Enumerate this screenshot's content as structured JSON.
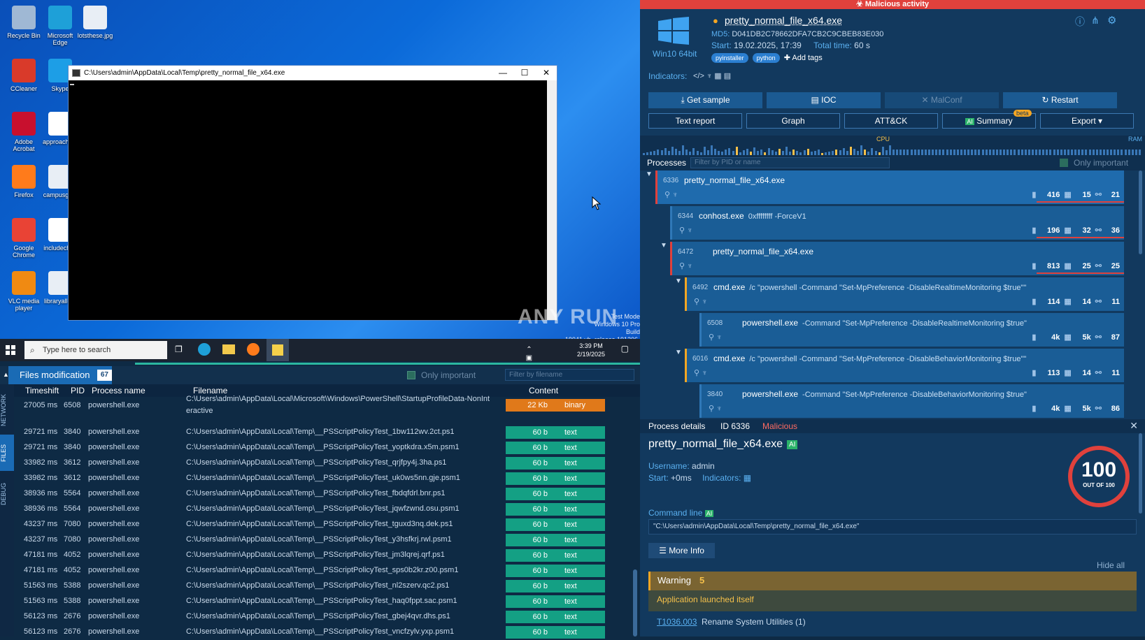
{
  "desktop": {
    "icons": [
      {
        "label": "Recycle Bin",
        "color": "#9fb8d4"
      },
      {
        "label": "Microsoft Edge",
        "color": "#1ea0d8"
      },
      {
        "label": "lotsthese.jpg",
        "color": "#e8eef5"
      },
      {
        "label": "CCleaner",
        "color": "#d93a2a"
      },
      {
        "label": "Skype",
        "color": "#1d9ee6"
      },
      {
        "label": "Adobe Acrobat",
        "color": "#c8102e"
      },
      {
        "label": "approachp...",
        "color": "#ffffff"
      },
      {
        "label": "Firefox",
        "color": "#ff7b1b"
      },
      {
        "label": "campusgif...",
        "color": "#e8eef5"
      },
      {
        "label": "Google Chrome",
        "color": "#e94335"
      },
      {
        "label": "includechi...",
        "color": "#ffffff"
      },
      {
        "label": "VLC media player",
        "color": "#f08a12"
      },
      {
        "label": "libraryallo...",
        "color": "#e8eef5"
      }
    ],
    "cmd_title": "C:\\Users\\admin\\AppData\\Local\\Temp\\pretty_normal_file_x64.exe",
    "watermark": "ANY RUN",
    "watermark_sub1": "Test Mode",
    "watermark_sub2": "Windows 10 Pro",
    "watermark_sub3": "Build 19041.vb_release.191206-1406"
  },
  "taskbar": {
    "search_placeholder": "Type here to search",
    "time": "3:39 PM",
    "date": "2/19/2025"
  },
  "files_panel": {
    "title": "Files modification",
    "count": "67",
    "only_important": "Only important",
    "filter_placeholder": "Filter by filename",
    "side_tabs": [
      "NETWORK",
      "FILES",
      "DEBUG"
    ],
    "headers": [
      "Timeshift",
      "PID",
      "Process name",
      "Filename",
      "Content"
    ],
    "rows": [
      {
        "time": "27005 ms",
        "pid": "6508",
        "proc": "powershell.exe",
        "file": "C:\\Users\\admin\\AppData\\Local\\Microsoft\\Windows\\PowerShell\\StartupProfileData-NonInt",
        "file2": "eractive",
        "size": "22 Kb",
        "type": "binary",
        "color": "#e0791a"
      },
      {
        "time": "29721 ms",
        "pid": "3840",
        "proc": "powershell.exe",
        "file": "C:\\Users\\admin\\AppData\\Local\\Temp\\__PSScriptPolicyTest_1bw112wv.2ct.ps1",
        "size": "60 b",
        "type": "text",
        "color": "#14a084"
      },
      {
        "time": "29721 ms",
        "pid": "3840",
        "proc": "powershell.exe",
        "file": "C:\\Users\\admin\\AppData\\Local\\Temp\\__PSScriptPolicyTest_yoptkdra.x5m.psm1",
        "size": "60 b",
        "type": "text",
        "color": "#14a084"
      },
      {
        "time": "33982 ms",
        "pid": "3612",
        "proc": "powershell.exe",
        "file": "C:\\Users\\admin\\AppData\\Local\\Temp\\__PSScriptPolicyTest_qrjfpy4j.3ha.ps1",
        "size": "60 b",
        "type": "text",
        "color": "#14a084"
      },
      {
        "time": "33982 ms",
        "pid": "3612",
        "proc": "powershell.exe",
        "file": "C:\\Users\\admin\\AppData\\Local\\Temp\\__PSScriptPolicyTest_uk0ws5nn.gje.psm1",
        "size": "60 b",
        "type": "text",
        "color": "#14a084"
      },
      {
        "time": "38936 ms",
        "pid": "5564",
        "proc": "powershell.exe",
        "file": "C:\\Users\\admin\\AppData\\Local\\Temp\\__PSScriptPolicyTest_fbdqfdrl.bnr.ps1",
        "size": "60 b",
        "type": "text",
        "color": "#14a084"
      },
      {
        "time": "38936 ms",
        "pid": "5564",
        "proc": "powershell.exe",
        "file": "C:\\Users\\admin\\AppData\\Local\\Temp\\__PSScriptPolicyTest_jqwfzwnd.osu.psm1",
        "size": "60 b",
        "type": "text",
        "color": "#14a084"
      },
      {
        "time": "43237 ms",
        "pid": "7080",
        "proc": "powershell.exe",
        "file": "C:\\Users\\admin\\AppData\\Local\\Temp\\__PSScriptPolicyTest_tguxd3nq.dek.ps1",
        "size": "60 b",
        "type": "text",
        "color": "#14a084"
      },
      {
        "time": "43237 ms",
        "pid": "7080",
        "proc": "powershell.exe",
        "file": "C:\\Users\\admin\\AppData\\Local\\Temp\\__PSScriptPolicyTest_y3hsfkrj.rwl.psm1",
        "size": "60 b",
        "type": "text",
        "color": "#14a084"
      },
      {
        "time": "47181 ms",
        "pid": "4052",
        "proc": "powershell.exe",
        "file": "C:\\Users\\admin\\AppData\\Local\\Temp\\__PSScriptPolicyTest_jm3lqrej.qrf.ps1",
        "size": "60 b",
        "type": "text",
        "color": "#14a084"
      },
      {
        "time": "47181 ms",
        "pid": "4052",
        "proc": "powershell.exe",
        "file": "C:\\Users\\admin\\AppData\\Local\\Temp\\__PSScriptPolicyTest_sps0b2kr.z00.psm1",
        "size": "60 b",
        "type": "text",
        "color": "#14a084"
      },
      {
        "time": "51563 ms",
        "pid": "5388",
        "proc": "powershell.exe",
        "file": "C:\\Users\\admin\\AppData\\Local\\Temp\\__PSScriptPolicyTest_nl2szerv.qc2.ps1",
        "size": "60 b",
        "type": "text",
        "color": "#14a084"
      },
      {
        "time": "51563 ms",
        "pid": "5388",
        "proc": "powershell.exe",
        "file": "C:\\Users\\admin\\AppData\\Local\\Temp\\__PSScriptPolicyTest_haq0fppt.sac.psm1",
        "size": "60 b",
        "type": "text",
        "color": "#14a084"
      },
      {
        "time": "56123 ms",
        "pid": "2676",
        "proc": "powershell.exe",
        "file": "C:\\Users\\admin\\AppData\\Local\\Temp\\__PSScriptPolicyTest_gbej4qvr.dhs.ps1",
        "size": "60 b",
        "type": "text",
        "color": "#14a084"
      },
      {
        "time": "56123 ms",
        "pid": "2676",
        "proc": "powershell.exe",
        "file": "C:\\Users\\admin\\AppData\\Local\\Temp\\__PSScriptPolicyTest_vncfzylv.yxp.psm1",
        "size": "60 b",
        "type": "text",
        "color": "#14a084"
      }
    ]
  },
  "report": {
    "banner": "Malicious activity",
    "filename": "pretty_normal_file_x64.exe",
    "os": "Win10 64bit",
    "md5_label": "MD5:",
    "md5": "D041DB2C78662DFA7CB2C9CBEB83E030",
    "start_label": "Start:",
    "start": "19.02.2025, 17:39",
    "total_label": "Total time:",
    "total": "60 s",
    "tags": [
      "pyinstaller",
      "python"
    ],
    "add_tags": "Add tags",
    "indicators_label": "Indicators:",
    "buttons_row1": [
      "Get sample",
      "IOC",
      "MalConf",
      "Restart"
    ],
    "buttons_row2": [
      "Text report",
      "Graph",
      "ATT&CK",
      "Summary",
      "Export"
    ],
    "beta": "beta",
    "cpu": "CPU",
    "ram": "RAM"
  },
  "processes": {
    "title": "Processes",
    "filter_placeholder": "Filter by PID or name",
    "only_important": "Only important",
    "items": [
      {
        "pid": "6336",
        "name": "pretty_normal_file_x64.exe",
        "args": "",
        "files": "416",
        "reg": "15",
        "net": "21",
        "indent": 0
      },
      {
        "pid": "6344",
        "name": "conhost.exe",
        "args": "0xffffffff -ForceV1",
        "files": "196",
        "reg": "32",
        "net": "36",
        "indent": 1
      },
      {
        "pid": "6472",
        "name": "pretty_normal_file_x64.exe",
        "args": "",
        "files": "813",
        "reg": "25",
        "net": "25",
        "indent": 1
      },
      {
        "pid": "6492",
        "name": "cmd.exe",
        "args": "/c \"powershell -Command \"Set-MpPreference -DisableRealtimeMonitoring $true\"\"",
        "files": "114",
        "reg": "14",
        "net": "11",
        "indent": 2
      },
      {
        "pid": "6508",
        "name": "powershell.exe",
        "args": "-Command \"Set-MpPreference -DisableRealtimeMonitoring $true\"",
        "files": "4k",
        "reg": "5k",
        "net": "87",
        "indent": 3
      },
      {
        "pid": "6016",
        "name": "cmd.exe",
        "args": "/c \"powershell -Command \"Set-MpPreference -DisableBehaviorMonitoring $true\"\"",
        "files": "113",
        "reg": "14",
        "net": "11",
        "indent": 2
      },
      {
        "pid": "3840",
        "name": "powershell.exe",
        "args": "-Command \"Set-MpPreference -DisableBehaviorMonitoring $true\"",
        "files": "4k",
        "reg": "5k",
        "net": "86",
        "indent": 3
      }
    ]
  },
  "details": {
    "title": "Process details",
    "id": "ID 6336",
    "status": "Malicious",
    "name": "pretty_normal_file_x64.exe",
    "ai": "AI",
    "username_label": "Username:",
    "username": "admin",
    "start_label": "Start:",
    "start": "+0ms",
    "indicators_label": "Indicators:",
    "score": "100",
    "score_sub": "OUT OF 100",
    "cmdline_label": "Command line",
    "cmdline": "\"C:\\Users\\admin\\AppData\\Local\\Temp\\pretty_normal_file_x64.exe\"",
    "more_info": "More Info",
    "hide_all": "Hide all",
    "warning_label": "Warning",
    "warning_count": "5",
    "warning_item": "Application launched itself",
    "technique_id": "T1036.003",
    "technique_name": "Rename System Utilities (1)"
  }
}
